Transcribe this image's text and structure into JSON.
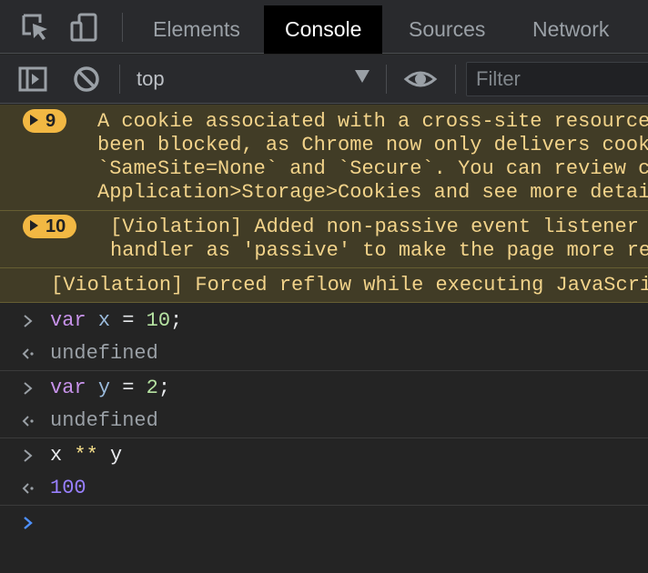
{
  "tabs": [
    {
      "label": "Elements",
      "active": false
    },
    {
      "label": "Console",
      "active": true
    },
    {
      "label": "Sources",
      "active": false
    },
    {
      "label": "Network",
      "active": false
    }
  ],
  "toolbar": {
    "context": "top",
    "filter_placeholder": "Filter"
  },
  "messages": [
    {
      "type": "warning",
      "count": "9",
      "lines": [
        "A cookie associated with a cross-site resource",
        "been blocked, as Chrome now only delivers cook",
        "`SameSite=None` and `Secure`. You can review c",
        "Application>Storage>Cookies and see more detai"
      ]
    },
    {
      "type": "warning",
      "count": "10",
      "lines": [
        "[Violation] Added non-passive event listener",
        "handler as 'passive' to make the page more re"
      ]
    },
    {
      "type": "warning",
      "lines": [
        "[Violation] Forced reflow while executing JavaScri"
      ]
    }
  ],
  "entries": [
    {
      "input": {
        "kw": "var",
        "name": "x",
        "op": "=",
        "value": "10",
        "end": ";"
      },
      "result": "undefined"
    },
    {
      "input": {
        "kw": "var",
        "name": "y",
        "op": "=",
        "value": "2",
        "end": ";"
      },
      "result": "undefined"
    },
    {
      "input": {
        "left": "x",
        "op": "**",
        "right": "y"
      },
      "result": "100"
    }
  ],
  "colors": {
    "accent_prompt": "#4d90fe",
    "warning_bg": "#413c26",
    "warning_text": "#f2d38a",
    "badge": "#f2b843",
    "keyword": "#c792ea",
    "number_result": "#9980ff"
  }
}
